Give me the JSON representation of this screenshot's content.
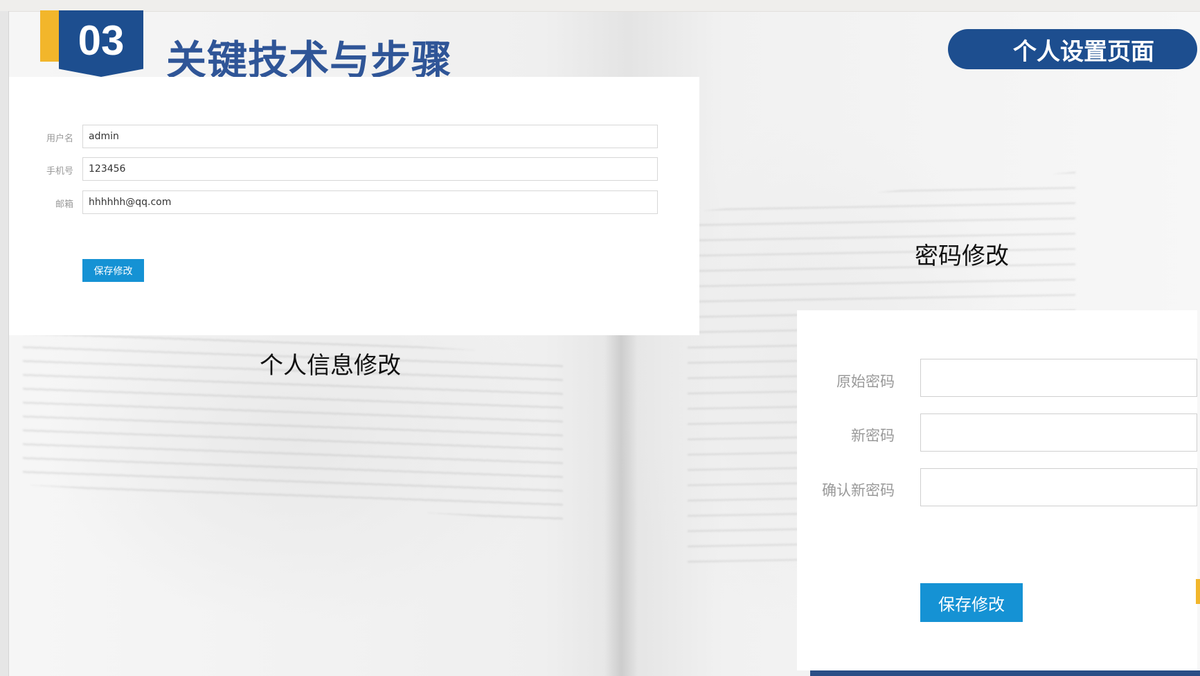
{
  "header": {
    "section_number": "03",
    "section_title": "关键技术与步骤",
    "page_tag": "个人设置页面"
  },
  "personal_info": {
    "fields": [
      {
        "label": "用户名",
        "value": "admin"
      },
      {
        "label": "手机号",
        "value": "123456"
      },
      {
        "label": "邮箱",
        "value": "hhhhhh@qq.com"
      }
    ],
    "save_label": "保存修改",
    "caption": "个人信息修改"
  },
  "password": {
    "caption": "密码修改",
    "fields": [
      {
        "label": "原始密码",
        "value": ""
      },
      {
        "label": "新密码",
        "value": ""
      },
      {
        "label": "确认新密码",
        "value": ""
      }
    ],
    "save_label": "保存修改"
  },
  "colors": {
    "brand_blue": "#1d4e8f",
    "title_blue": "#2f5597",
    "accent_yellow": "#f2b62b",
    "button_blue": "#1592d4"
  }
}
